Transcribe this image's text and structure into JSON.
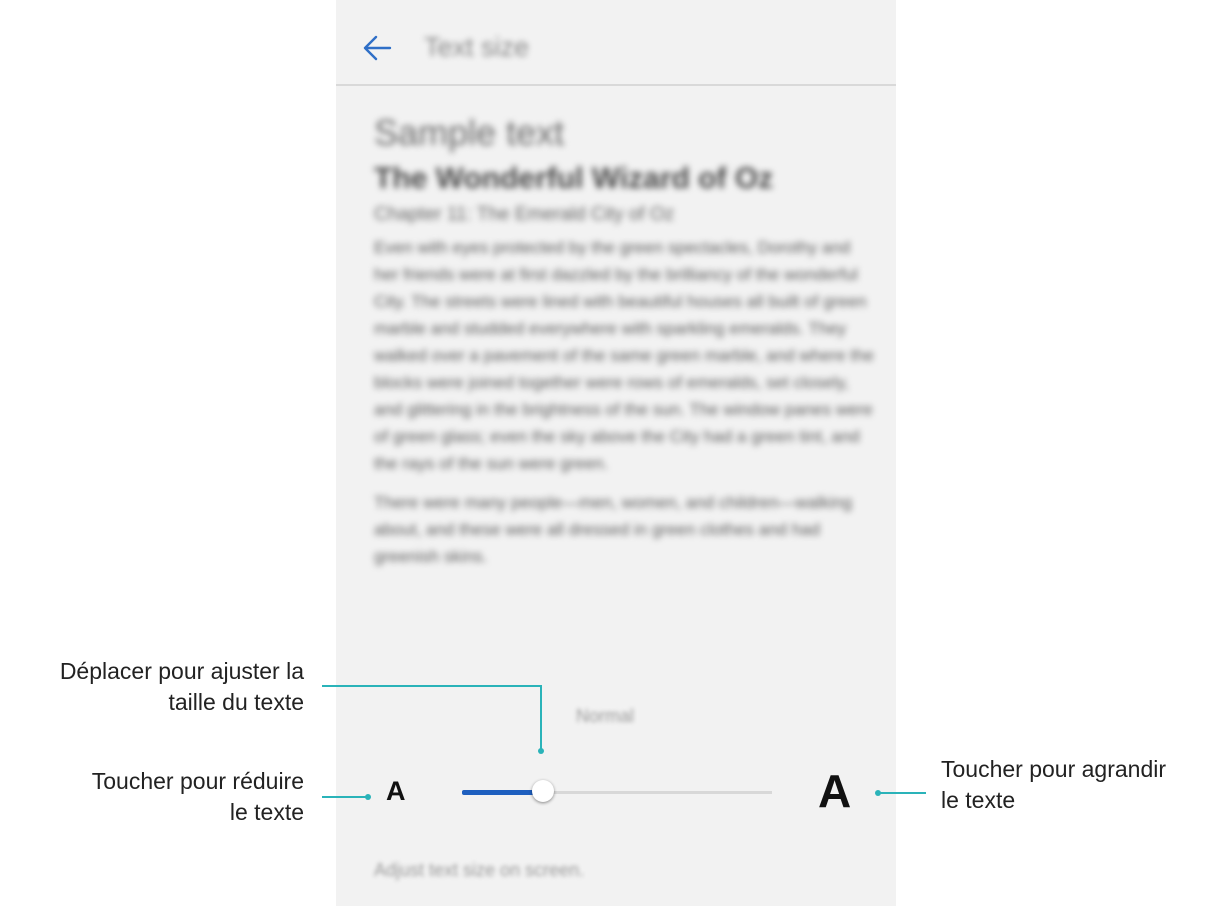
{
  "header": {
    "title": "Text size",
    "back_icon": "back-arrow-icon"
  },
  "preview": {
    "heading": "Sample text",
    "book_title": "The Wonderful Wizard of Oz",
    "chapter": "Chapter 11: The Emerald City of Oz",
    "paragraph_1": "Even with eyes protected by the green spectacles, Dorothy and her friends were at first dazzled by the brilliancy of the wonderful City. The streets were lined with beautiful houses all built of green marble and studded everywhere with sparkling emeralds. They walked over a pavement of the same green marble, and where the blocks were joined together were rows of emeralds, set closely, and glittering in the brightness of the sun. The window panes were of green glass; even the sky above the City had a green tint, and the rays of the sun were green.",
    "paragraph_2": "There were many people—men, women, and children—walking about, and these were all dressed in green clothes and had greenish skins."
  },
  "slider": {
    "value_label": "Normal",
    "decrease_label": "A",
    "increase_label": "A",
    "level_fraction": 0.26
  },
  "footer": {
    "description": "Adjust text size on screen."
  },
  "callouts": {
    "drag_line1": "Déplacer pour ajuster la",
    "drag_line2": "taille du texte",
    "reduce_line1": "Toucher pour réduire",
    "reduce_line2": "le texte",
    "enlarge_line1": "Toucher pour agrandir",
    "enlarge_line2": "le texte"
  },
  "colors": {
    "accent": "#1e5fbf",
    "callout_line": "#2ab3b9",
    "screen_bg": "#f2f2f2"
  }
}
